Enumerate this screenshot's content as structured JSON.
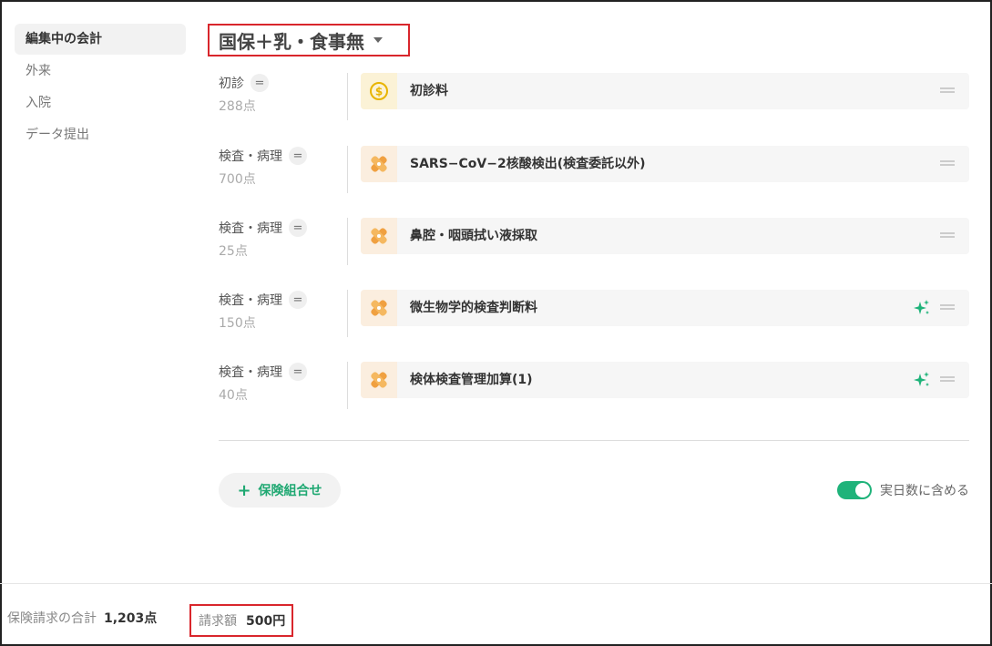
{
  "sidebar": {
    "items": [
      {
        "label": "編集中の会計"
      },
      {
        "label": "外来"
      },
      {
        "label": "入院"
      },
      {
        "label": "データ提出"
      }
    ]
  },
  "header": {
    "title": "国保＋乳・食事無"
  },
  "rows": [
    {
      "category": "初診",
      "points": "288点",
      "item": "初診料",
      "icon": "coin-icon"
    },
    {
      "category": "検査・病理",
      "points": "700点",
      "item": "SARS−CoV−2核酸検出(検査委託以外)",
      "icon": "bandage-icon"
    },
    {
      "category": "検査・病理",
      "points": "25点",
      "item": "鼻腔・咽頭拭い液採取",
      "icon": "bandage-icon"
    },
    {
      "category": "検査・病理",
      "points": "150点",
      "item": "微生物学的検査判断料",
      "icon": "bandage-icon",
      "sparkle": true
    },
    {
      "category": "検査・病理",
      "points": "40点",
      "item": "検体検査管理加算(1)",
      "icon": "bandage-icon",
      "sparkle": true
    }
  ],
  "eq_symbol": "=",
  "add_button": {
    "icon": "+",
    "label": "保険組合せ"
  },
  "toggle": {
    "label": "実日数に含める",
    "on": true
  },
  "footer": {
    "total_label": "保険請求の合計",
    "total_value": "1,203点",
    "claim_label": "請求額",
    "claim_value": "500円"
  },
  "colors": {
    "accent": "#1fb37a",
    "highlight_border": "#d9262c",
    "coin": "#e8b400",
    "bandage": "#f0a040"
  }
}
